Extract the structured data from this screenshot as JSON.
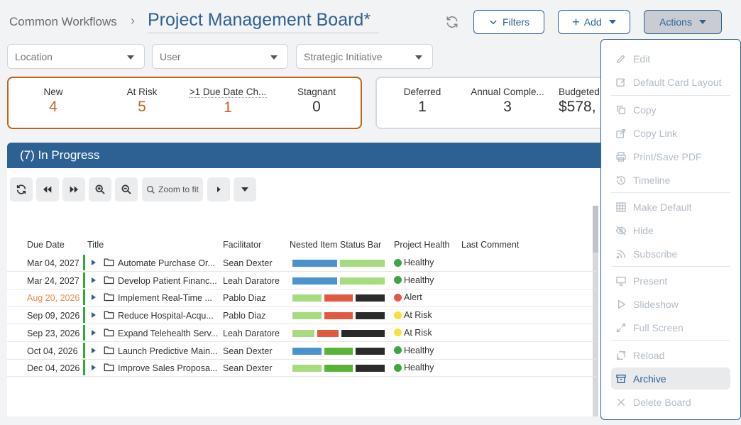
{
  "header": {
    "breadcrumb": "Common Workflows",
    "title": "Project Management Board*",
    "filters_label": "Filters",
    "add_label": "Add",
    "actions_label": "Actions"
  },
  "filters": {
    "location": "Location",
    "user": "User",
    "strategic": "Strategic Initiative"
  },
  "stats": [
    {
      "label": "New",
      "value": "4"
    },
    {
      "label": "At Risk",
      "value": "5"
    },
    {
      "label": ">1 Due Date Ch...",
      "value": "1"
    },
    {
      "label": "Stagnant",
      "value": "0"
    },
    {
      "label": "Deferred",
      "value": "1"
    },
    {
      "label": "Annual Comple...",
      "value": "3"
    },
    {
      "label": "Budgeted",
      "value": "$578,"
    }
  ],
  "section": {
    "title": "(7) In Progress"
  },
  "toolbar": {
    "zoom_fit": "Zoom to fit"
  },
  "table": {
    "headers": [
      "Due Date",
      "Title",
      "Facilitator",
      "Nested Item Status Bar",
      "Project Health",
      "Last Comment"
    ],
    "rows": [
      {
        "due": "Mar 04, 2027",
        "title": "Automate Purchase Or...",
        "facilitator": "Sean Dexter",
        "health": "Healthy"
      },
      {
        "due": "Mar 24, 2027",
        "title": "Develop Patient Financ...",
        "facilitator": "Leah Daratore",
        "health": "Healthy"
      },
      {
        "due": "Aug 20, 2026",
        "title": "Implement Real-Time ...",
        "facilitator": "Pablo Diaz",
        "health": "Alert"
      },
      {
        "due": "Sep 09, 2026",
        "title": "Reduce Hospital-Acqu...",
        "facilitator": "Pablo Diaz",
        "health": "At Risk"
      },
      {
        "due": "Sep 23, 2026",
        "title": "Expand Telehealth Serv...",
        "facilitator": "Leah Daratore",
        "health": "At Risk"
      },
      {
        "due": "Oct 04, 2026",
        "title": "Launch Predictive Main...",
        "facilitator": "Sean Dexter",
        "health": "Healthy"
      },
      {
        "due": "Dec 04, 2026",
        "title": "Improve Sales Proposa...",
        "facilitator": "Sean Dexter",
        "health": "Healthy"
      }
    ]
  },
  "menu": {
    "items": [
      "Edit",
      "Default Card Layout",
      "Copy",
      "Copy Link",
      "Print/Save PDF",
      "Timeline",
      "Make Default",
      "Hide",
      "Subscribe",
      "Present",
      "Slideshow",
      "Full Screen",
      "Reload",
      "Archive",
      "Delete Board"
    ]
  },
  "colors": {
    "brand": "#2d6193",
    "orange": "#c8631d",
    "healthy": "#3aa83f",
    "alert": "#e05a43",
    "at_risk": "#f4e13a",
    "bar_blue": "#4b93cf",
    "bar_lightgreen": "#a6dc7f",
    "bar_red": "#e05a43",
    "bar_black": "#2b2b2b",
    "bar_green": "#59b335"
  }
}
